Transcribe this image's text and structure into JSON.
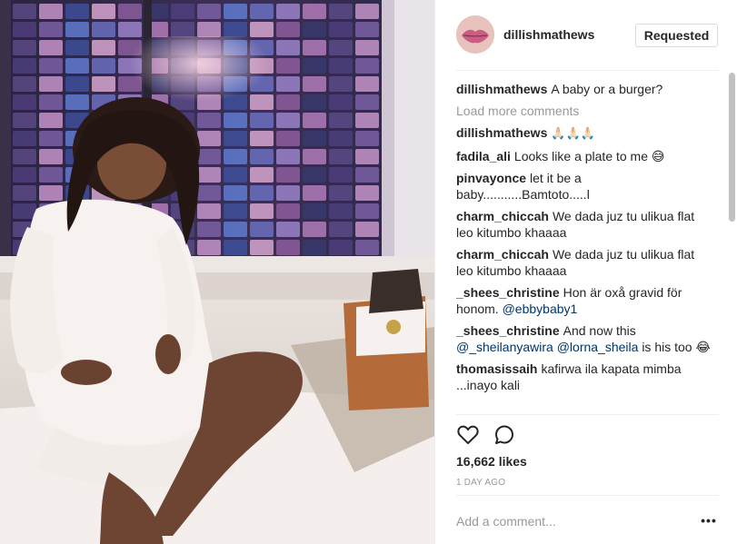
{
  "post": {
    "username": "dillishmathews",
    "follow_label": "Requested"
  },
  "comments_section": {
    "caption_author": "dillishmathews",
    "caption_text": "A baby or a burger?",
    "load_more": "Load more comments",
    "comments": [
      {
        "author": "dillishmathews",
        "text": "🙏🏻🙏🏻🙏🏻"
      },
      {
        "author": "fadila_ali",
        "text": "Looks like a plate to me 😅"
      },
      {
        "author": "pinvayonce",
        "text": "let it be a baby...........Bamtoto.....l"
      },
      {
        "author": "charm_chiccah",
        "text": "We dada juz tu ulikua flat leo kitumbo khaaaa"
      },
      {
        "author": "charm_chiccah",
        "text": "We dada juz tu ulikua flat leo kitumbo khaaaa"
      },
      {
        "author": "_shees_christine",
        "text": "Hon är oxå gravid för honom.",
        "mention": "@ebbybaby1"
      },
      {
        "author": "_shees_christine",
        "text": "And now this",
        "mention": "@_sheilanyawira @lorna_sheila",
        "text_after": "is his too 😂"
      },
      {
        "author": "thomasissaih",
        "text": "kafirwa ila kapata mimba ...inayo kali"
      }
    ]
  },
  "actions": {
    "like_icon": "heart-icon",
    "comment_icon": "comment-icon"
  },
  "stats": {
    "likes": "16,662 likes",
    "time": "1 DAY AGO"
  },
  "composer": {
    "placeholder": "Add a comment...",
    "more_label": "•••"
  }
}
